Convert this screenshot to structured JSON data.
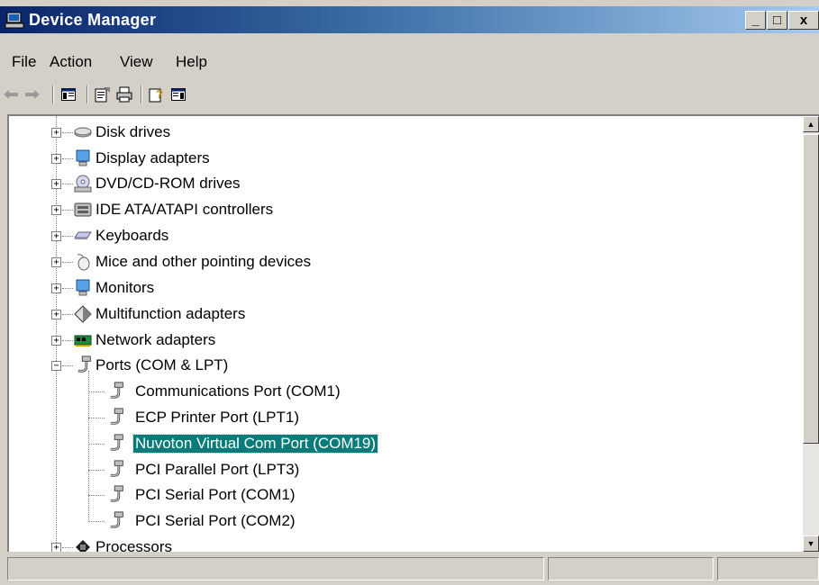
{
  "window": {
    "title": "Device Manager"
  },
  "title_buttons": {
    "minimize": "_",
    "maximize": "□",
    "close": "x"
  },
  "menu": [
    "File",
    "Action",
    "View",
    "Help"
  ],
  "toolbar": {
    "icons": [
      "back-arrow-icon",
      "forward-arrow-icon",
      "show-hide-tree-icon",
      "properties-icon",
      "print-icon",
      "help-icon",
      "action-pane-icon"
    ]
  },
  "tree": {
    "categories": [
      {
        "label": "Disk drives",
        "icon": "disk-drive-icon",
        "expanded": false
      },
      {
        "label": "Display adapters",
        "icon": "monitor-icon",
        "expanded": false
      },
      {
        "label": "DVD/CD-ROM drives",
        "icon": "cdrom-icon",
        "expanded": false
      },
      {
        "label": "IDE ATA/ATAPI controllers",
        "icon": "ide-controller-icon",
        "expanded": false
      },
      {
        "label": "Keyboards",
        "icon": "keyboard-icon",
        "expanded": false
      },
      {
        "label": "Mice and other pointing devices",
        "icon": "mouse-icon",
        "expanded": false
      },
      {
        "label": "Monitors",
        "icon": "monitor-icon",
        "expanded": false
      },
      {
        "label": "Multifunction adapters",
        "icon": "diamond-icon",
        "expanded": false
      },
      {
        "label": "Network adapters",
        "icon": "network-card-icon",
        "expanded": false
      },
      {
        "label": "Ports (COM & LPT)",
        "icon": "port-plug-icon",
        "expanded": true
      }
    ],
    "ports_children": [
      {
        "label": "Communications Port (COM1)",
        "selected": false
      },
      {
        "label": "ECP Printer Port (LPT1)",
        "selected": false
      },
      {
        "label": "Nuvoton Virtual Com Port (COM19)",
        "selected": true
      },
      {
        "label": "PCI Parallel Port (LPT3)",
        "selected": false
      },
      {
        "label": "PCI Serial Port (COM1)",
        "selected": false
      },
      {
        "label": "PCI Serial Port (COM2)",
        "selected": false
      }
    ],
    "after": [
      {
        "label": "Processors",
        "icon": "processor-icon",
        "expanded": false
      }
    ]
  },
  "colors": {
    "selection": "#0a7b7b",
    "titlebar_start": "#0a246a"
  }
}
